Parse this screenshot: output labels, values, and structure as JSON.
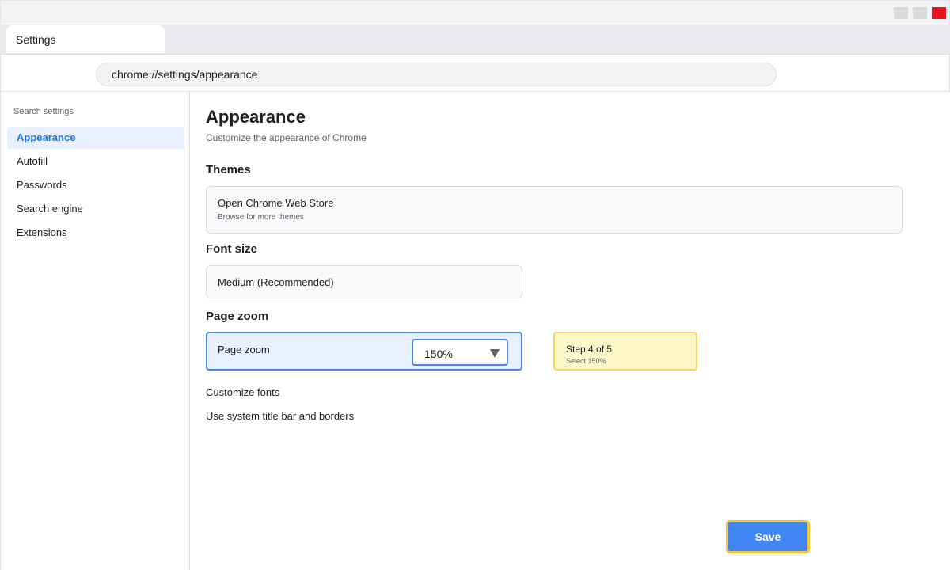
{
  "window": {
    "controls": [
      "minimize",
      "maximize",
      "close"
    ],
    "close_color": "#e8131f"
  },
  "tab": {
    "title": "Settings"
  },
  "address_bar": {
    "url": "chrome://settings/appearance"
  },
  "sidebar": {
    "search_placeholder": "Search settings",
    "items": [
      {
        "label": "Appearance",
        "active": true
      },
      {
        "label": "Autofill",
        "active": false
      },
      {
        "label": "Passwords",
        "active": false
      },
      {
        "label": "Search engine",
        "active": false
      },
      {
        "label": "Extensions",
        "active": false
      }
    ]
  },
  "main": {
    "title": "Appearance",
    "subtitle": "Customize the appearance of Chrome",
    "themes": {
      "heading": "Themes",
      "card_title": "Open Chrome Web Store",
      "card_subtitle": "Browse for more themes"
    },
    "font_size": {
      "heading": "Font size",
      "value": "Medium (Recommended)"
    },
    "page_zoom": {
      "heading": "Page zoom",
      "label": "Page zoom",
      "value": "150%"
    },
    "step_hint": {
      "title": "Step 4 of 5",
      "subtitle": "Select 150%"
    },
    "links": {
      "customize_fonts": "Customize fonts",
      "system_title_bar": "Use system title bar and borders"
    },
    "save_label": "Save"
  },
  "colors": {
    "accent": "#4285f4",
    "active_nav_bg": "#e8f0fe",
    "active_nav_text": "#1a73e8",
    "highlight_border": "#f7c531",
    "step_bg": "#fef8c9"
  }
}
